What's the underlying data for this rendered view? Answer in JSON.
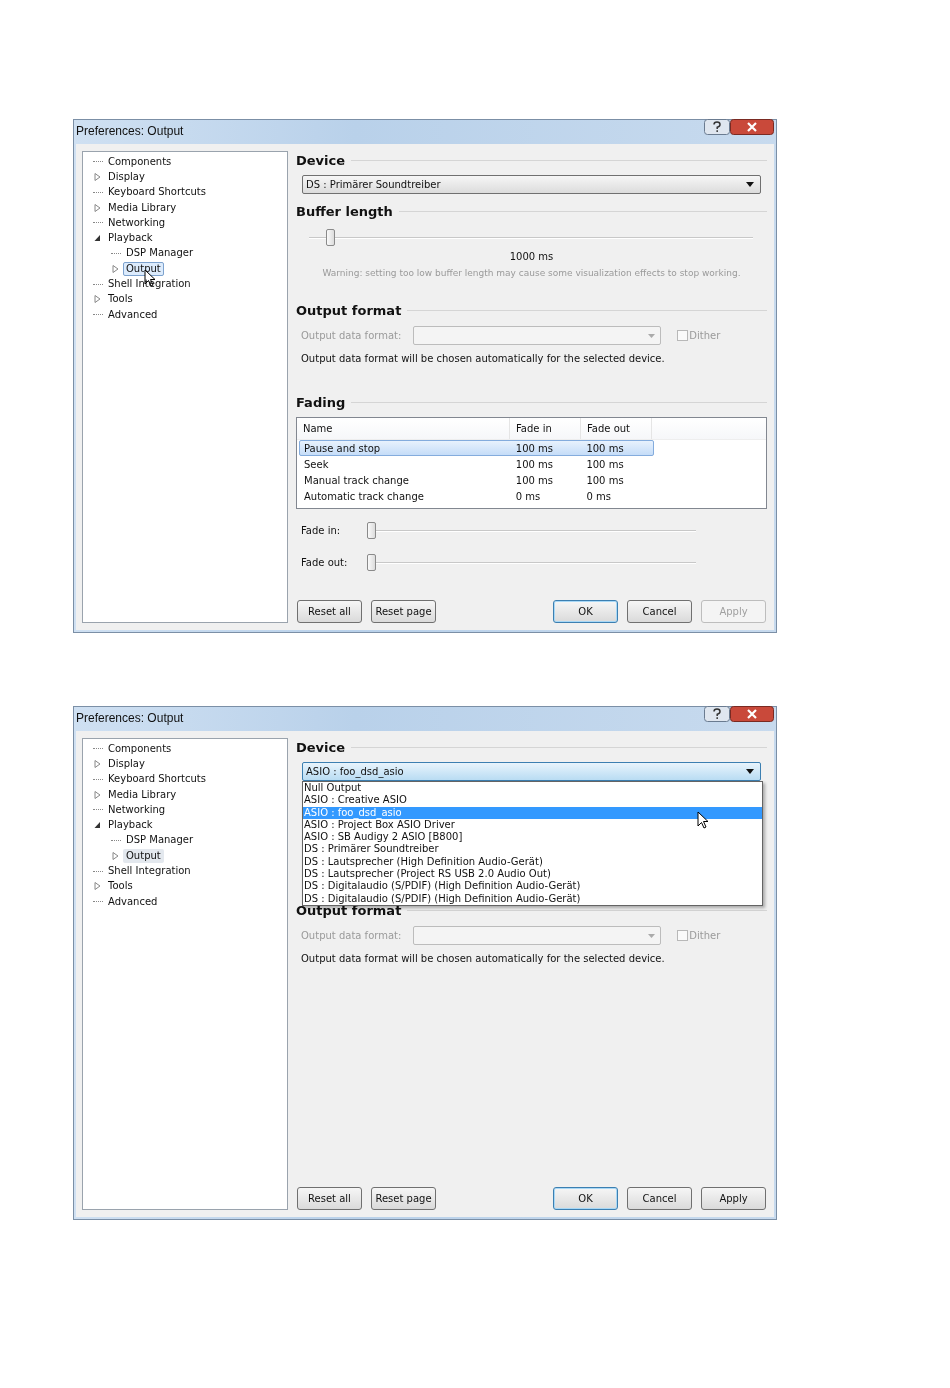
{
  "windows": [
    {
      "title": "Preferences: Output",
      "tree": [
        {
          "label": "Components",
          "selected": false
        },
        {
          "label": "Display",
          "expanded": false,
          "selected": false
        },
        {
          "label": "Keyboard Shortcuts",
          "selected": false
        },
        {
          "label": "Media Library",
          "expanded": false,
          "selected": false
        },
        {
          "label": "Networking",
          "selected": false
        },
        {
          "label": "Playback",
          "expanded": true,
          "selected": false,
          "children": [
            {
              "label": "DSP Manager",
              "selected": false
            },
            {
              "label": "Output",
              "expanded": false,
              "selected": true
            }
          ]
        },
        {
          "label": "Shell Integration",
          "selected": false
        },
        {
          "label": "Tools",
          "expanded": false,
          "selected": false
        },
        {
          "label": "Advanced",
          "selected": false
        }
      ],
      "tree_focused": true,
      "device": {
        "heading": "Device",
        "value": "DS : Primärer Soundtreiber",
        "open": false
      },
      "buffer": {
        "heading": "Buffer length",
        "level": 0.04,
        "reading": "1000 ms",
        "warning": "Warning: setting too low buffer length may cause some visualization effects to stop working."
      },
      "output_format": {
        "heading": "Output format",
        "label": "Output data format:",
        "dither": {
          "label": "Dither",
          "checked": false
        },
        "note": "Output data format will be chosen automatically for the selected device."
      },
      "fading": {
        "heading": "Fading",
        "columns": [
          "Name",
          "Fade in",
          "Fade out"
        ],
        "rows": [
          {
            "cells": [
              "Pause and stop",
              "100 ms",
              "100 ms"
            ],
            "selected": true
          },
          {
            "cells": [
              "Seek",
              "100 ms",
              "100 ms"
            ],
            "selected": false
          },
          {
            "cells": [
              "Manual track change",
              "100 ms",
              "100 ms"
            ],
            "selected": false
          },
          {
            "cells": [
              "Automatic track change",
              "0 ms",
              "0 ms"
            ],
            "selected": false
          }
        ],
        "sliders": [
          {
            "label": "Fade in:",
            "level": 0
          },
          {
            "label": "Fade out:",
            "level": 0
          }
        ]
      },
      "buttons": [
        {
          "label": "Reset all",
          "kind": "normal",
          "disabled": false
        },
        {
          "label": "Reset page",
          "kind": "normal",
          "disabled": false
        },
        {
          "label": "OK",
          "kind": "default",
          "disabled": false
        },
        {
          "label": "Cancel",
          "kind": "normal",
          "disabled": false
        },
        {
          "label": "Apply",
          "kind": "normal",
          "disabled": true
        }
      ]
    },
    {
      "title": "Preferences: Output",
      "tree": [
        {
          "label": "Components",
          "selected": false
        },
        {
          "label": "Display",
          "expanded": false,
          "selected": false
        },
        {
          "label": "Keyboard Shortcuts",
          "selected": false
        },
        {
          "label": "Media Library",
          "expanded": false,
          "selected": false
        },
        {
          "label": "Networking",
          "selected": false
        },
        {
          "label": "Playback",
          "expanded": true,
          "selected": false,
          "children": [
            {
              "label": "DSP Manager",
              "selected": false
            },
            {
              "label": "Output",
              "expanded": false,
              "selected": true
            }
          ]
        },
        {
          "label": "Shell Integration",
          "selected": false
        },
        {
          "label": "Tools",
          "expanded": false,
          "selected": false
        },
        {
          "label": "Advanced",
          "selected": false
        }
      ],
      "tree_focused": false,
      "device": {
        "heading": "Device",
        "value": "ASIO : foo_dsd_asio",
        "open": true,
        "options": [
          {
            "label": "Null Output",
            "selected": false
          },
          {
            "label": "ASIO : Creative ASIO",
            "selected": false
          },
          {
            "label": "ASIO : foo_dsd_asio",
            "selected": true
          },
          {
            "label": "ASIO : Project Box ASIO Driver",
            "selected": false
          },
          {
            "label": "ASIO : SB Audigy 2 ASIO [B800]",
            "selected": false
          },
          {
            "label": "DS : Primärer Soundtreiber",
            "selected": false
          },
          {
            "label": "DS : Lautsprecher (High Definition Audio-Gerät)",
            "selected": false
          },
          {
            "label": "DS : Lautsprecher (Project RS USB 2.0 Audio Out)",
            "selected": false
          },
          {
            "label": "DS : Digitalaudio (S/PDIF) (High Definition Audio-Gerät)",
            "selected": false
          },
          {
            "label": "DS : Digitalaudio (S/PDIF) (High Definition Audio-Gerät)",
            "selected": false
          }
        ]
      },
      "output_format": {
        "heading": "Output format",
        "label": "Output data format:",
        "dither": {
          "label": "Dither",
          "checked": false
        },
        "note": "Output data format will be chosen automatically for the selected device."
      },
      "buttons": [
        {
          "label": "Reset all",
          "kind": "normal",
          "disabled": false
        },
        {
          "label": "Reset page",
          "kind": "normal",
          "disabled": false
        },
        {
          "label": "OK",
          "kind": "default",
          "disabled": false
        },
        {
          "label": "Cancel",
          "kind": "normal",
          "disabled": false
        },
        {
          "label": "Apply",
          "kind": "normal",
          "disabled": false
        }
      ]
    }
  ]
}
